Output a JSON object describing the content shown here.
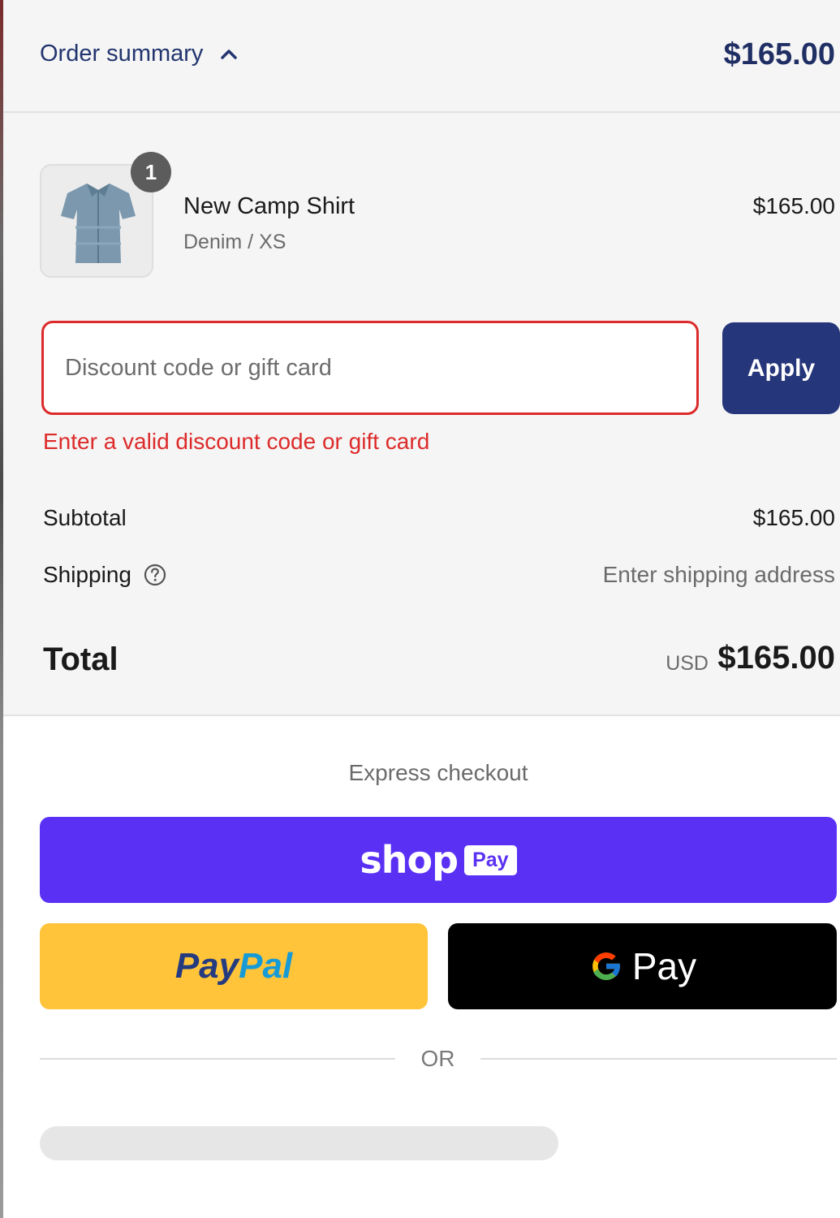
{
  "summary": {
    "toggle_label": "Order summary",
    "header_total": "$165.00"
  },
  "product": {
    "quantity": "1",
    "name": "New Camp Shirt",
    "variant": "Denim / XS",
    "price": "$165.00"
  },
  "discount": {
    "placeholder": "Discount code or gift card",
    "value": "",
    "apply_label": "Apply",
    "error": "Enter a valid discount code or gift card"
  },
  "totals": {
    "subtotal_label": "Subtotal",
    "subtotal_value": "$165.00",
    "shipping_label": "Shipping",
    "shipping_value": "Enter shipping address",
    "total_label": "Total",
    "currency": "USD",
    "total_value": "$165.00"
  },
  "express": {
    "title": "Express checkout",
    "shop_word": "shop",
    "shop_pay_chip": "Pay",
    "paypal_pay": "Pay",
    "paypal_pal": "Pal",
    "gpay_text": "Pay",
    "or_text": "OR"
  },
  "colors": {
    "accent_navy": "#26367a",
    "error_red": "#dd2a2a",
    "shop_pay_purple": "#5a31f4",
    "paypal_yellow": "#ffc439",
    "gpay_black": "#000000"
  },
  "icons": {
    "toggle": "chevron-up-icon",
    "shipping_help": "question-circle-icon",
    "gpay": "google-g-icon"
  }
}
